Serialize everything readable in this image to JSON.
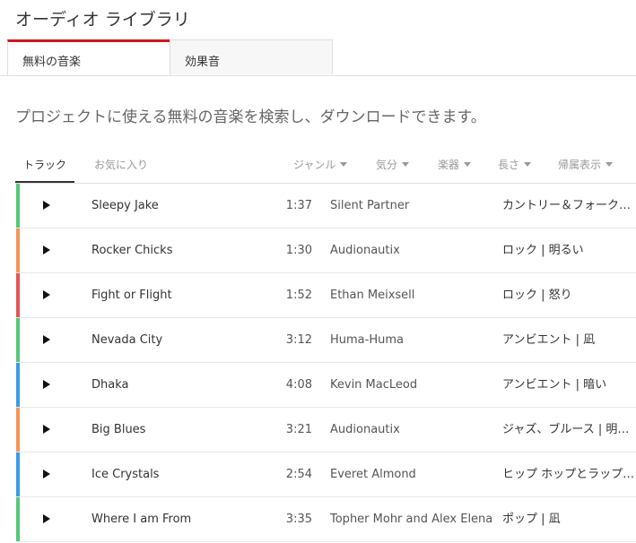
{
  "page": {
    "title": "オーディオ ライブラリ"
  },
  "tabs": [
    {
      "label": "無料の音楽",
      "active": true
    },
    {
      "label": "効果音",
      "active": false
    }
  ],
  "description": "プロジェクトに使える無料の音楽を検索し、ダウンロードできます。",
  "filters": {
    "tracks_tab": "トラック",
    "favorites_tab": "お気に入り",
    "genre": "ジャンル",
    "mood": "気分",
    "instrument": "楽器",
    "duration": "長さ",
    "attribution": "帰属表示"
  },
  "colors": {
    "green": "#58c77a",
    "orange": "#f0965a",
    "red": "#e35455",
    "blue": "#3a9ce2",
    "accent": "#cc181e"
  },
  "tracks": [
    {
      "title": "Sleepy Jake",
      "duration": "1:37",
      "artist": "Silent Partner",
      "genre": "カントリー＆フォーク…",
      "color": "#58c77a"
    },
    {
      "title": "Rocker Chicks",
      "duration": "1:30",
      "artist": "Audionautix",
      "genre": "ロック | 明るい",
      "color": "#f0965a"
    },
    {
      "title": "Fight or Flight",
      "duration": "1:52",
      "artist": "Ethan Meixsell",
      "genre": "ロック | 怒り",
      "color": "#e35455"
    },
    {
      "title": "Nevada City",
      "duration": "3:12",
      "artist": "Huma-Huma",
      "genre": "アンビエント | 凪",
      "color": "#58c77a"
    },
    {
      "title": "Dhaka",
      "duration": "4:08",
      "artist": "Kevin MacLeod",
      "genre": "アンビエント | 暗い",
      "color": "#3a9ce2"
    },
    {
      "title": "Big Blues",
      "duration": "3:21",
      "artist": "Audionautix",
      "genre": "ジャズ、ブルース | 明…",
      "color": "#f0965a"
    },
    {
      "title": "Ice Crystals",
      "duration": "2:54",
      "artist": "Everet Almond",
      "genre": "ヒップ ホップとラップ…",
      "color": "#3a9ce2"
    },
    {
      "title": "Where I am From",
      "duration": "3:35",
      "artist": "Topher Mohr and Alex Elena",
      "genre": "ポップ | 凪",
      "color": "#58c77a"
    }
  ]
}
